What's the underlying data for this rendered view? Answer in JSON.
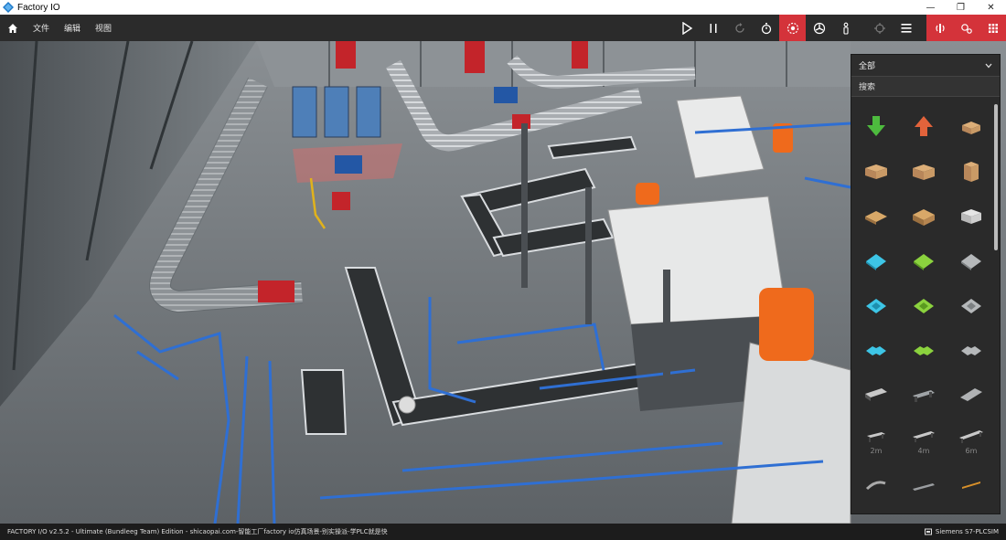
{
  "window": {
    "title": "Factory IO",
    "minimize": "—",
    "restore": "❐",
    "close": "✕"
  },
  "menu": {
    "items": [
      "文件",
      "编辑",
      "视图"
    ]
  },
  "toolbar": {
    "buttons": [
      "play-icon",
      "pause-icon",
      "reset-icon",
      "timer-icon",
      "camera-orbit-icon",
      "fan-icon",
      "first-person-icon",
      "target-icon",
      "list-icon",
      "sensor-icon",
      "drivers-icon",
      "grid-icon"
    ],
    "accent": "#d4333a"
  },
  "panel": {
    "category": "全部",
    "search_label": "搜索",
    "items": [
      {
        "icon": "sink-arrow-icon",
        "caption": ""
      },
      {
        "icon": "emitter-arrow-icon",
        "caption": ""
      },
      {
        "icon": "small-box-icon",
        "caption": ""
      },
      {
        "icon": "medium-box-icon",
        "caption": ""
      },
      {
        "icon": "large-box-icon",
        "caption": ""
      },
      {
        "icon": "tall-box-icon",
        "caption": ""
      },
      {
        "icon": "pallet-icon",
        "caption": ""
      },
      {
        "icon": "stacked-pallet-icon",
        "caption": ""
      },
      {
        "icon": "stackable-box-icon",
        "caption": ""
      },
      {
        "icon": "blue-raw-material-icon",
        "caption": ""
      },
      {
        "icon": "green-raw-material-icon",
        "caption": ""
      },
      {
        "icon": "metal-raw-material-icon",
        "caption": ""
      },
      {
        "icon": "blue-product-base-icon",
        "caption": ""
      },
      {
        "icon": "green-product-base-icon",
        "caption": ""
      },
      {
        "icon": "metal-product-base-icon",
        "caption": ""
      },
      {
        "icon": "blue-product-lid-icon",
        "caption": ""
      },
      {
        "icon": "green-product-lid-icon",
        "caption": ""
      },
      {
        "icon": "metal-product-lid-icon",
        "caption": ""
      },
      {
        "icon": "roller-conveyor-icon",
        "caption": ""
      },
      {
        "icon": "light-conveyor-icon",
        "caption": ""
      },
      {
        "icon": "plate-icon",
        "caption": ""
      },
      {
        "icon": "roller-2m-icon",
        "caption": "2m"
      },
      {
        "icon": "roller-4m-icon",
        "caption": "4m"
      },
      {
        "icon": "roller-6m-icon",
        "caption": "6m"
      },
      {
        "icon": "curved-icon",
        "caption": ""
      },
      {
        "icon": "ramp-icon",
        "caption": ""
      },
      {
        "icon": "rail-icon",
        "caption": ""
      }
    ]
  },
  "status": {
    "left": "FACTORY I/O v2.5.2 - Ultimate (Bundleeg Team) Edition - shicaopai.com-智能工厂factory io仿真场景-别实操派-学PLC就是快",
    "right": "Siemens S7-PLCSIM"
  }
}
